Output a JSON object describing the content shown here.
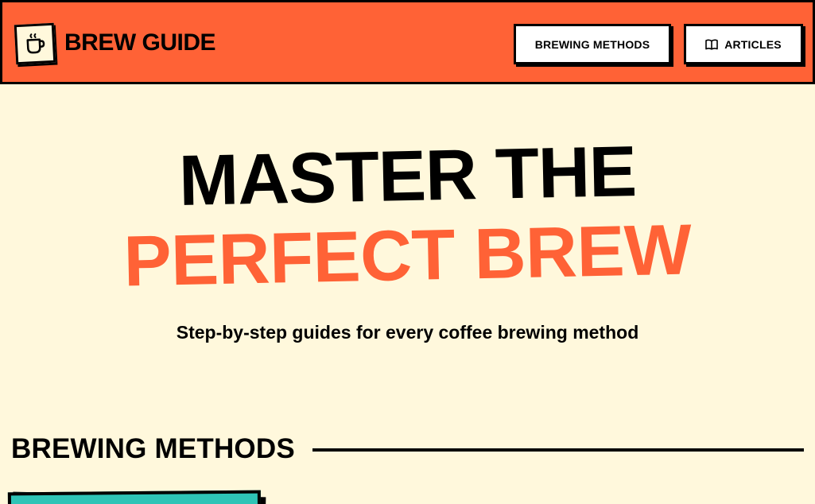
{
  "header": {
    "brand": "BREW GUIDE",
    "logo_icon": "coffee-cup-icon",
    "nav": [
      {
        "label": "BREWING METHODS",
        "icon": ""
      },
      {
        "label": "ARTICLES",
        "icon": "book-open-icon"
      }
    ]
  },
  "hero": {
    "line1": "MASTER THE",
    "line2": "PERFECT BREW",
    "subtitle": "Step-by-step guides for every coffee brewing method"
  },
  "section": {
    "title": "BREWING METHODS"
  },
  "colors": {
    "accent": "#ff6236",
    "background": "#fff8dc",
    "card": "#2ec4b6",
    "ink": "#000000"
  }
}
